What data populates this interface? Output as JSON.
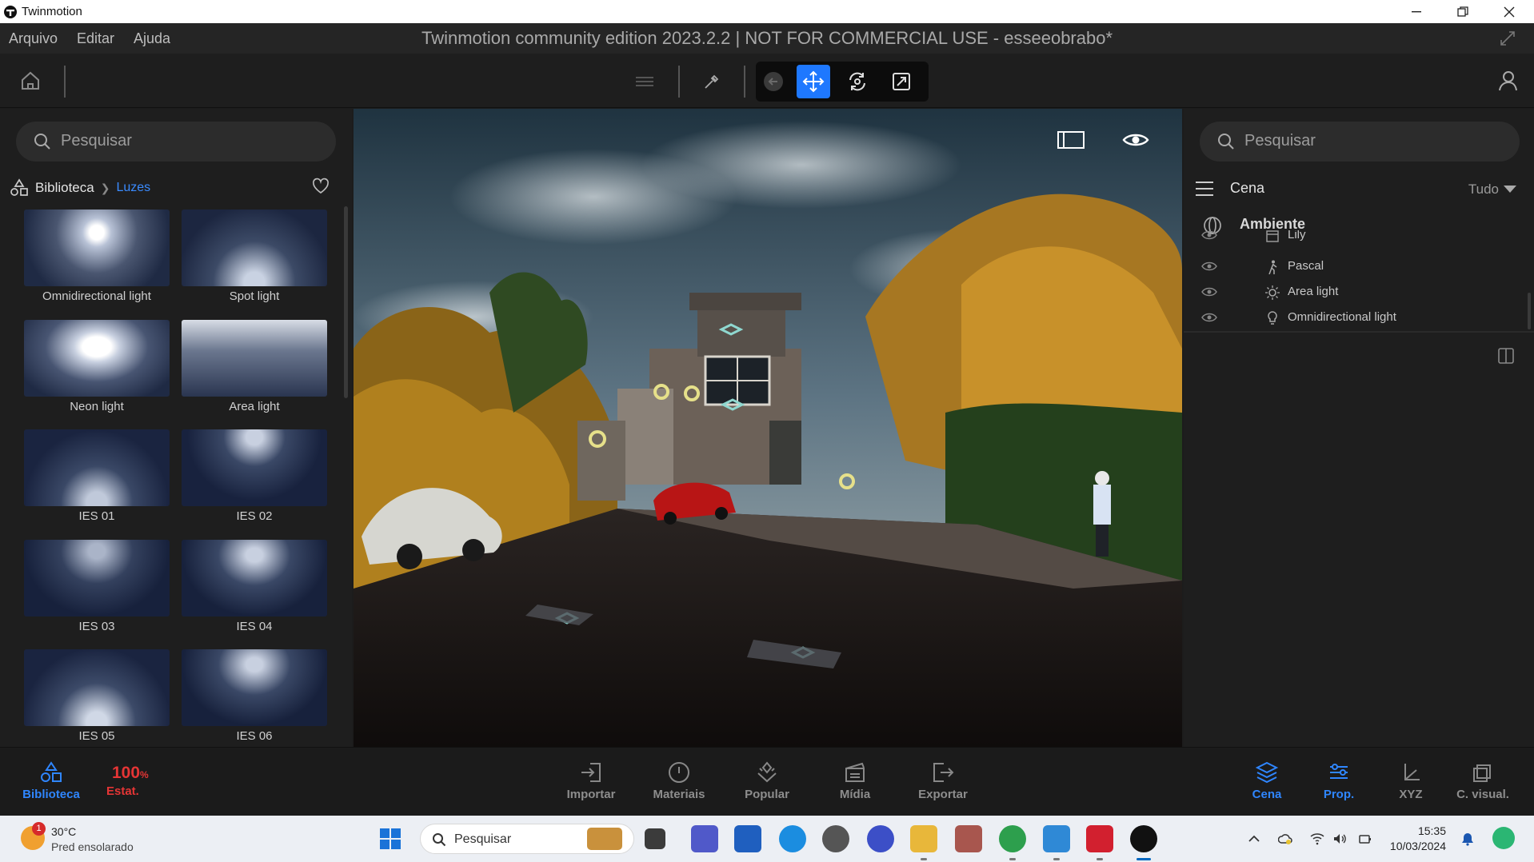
{
  "window": {
    "title": "Twinmotion",
    "app_title": "Twinmotion community edition 2023.2.2 | NOT FOR COMMERCIAL USE - esseeobrabo*"
  },
  "menu": {
    "items": [
      "Arquivo",
      "Editar",
      "Ajuda"
    ]
  },
  "library": {
    "search_placeholder": "Pesquisar",
    "breadcrumb_root": "Biblioteca",
    "breadcrumb_current": "Luzes",
    "items": [
      "Omnidirectional light",
      "Spot light",
      "Neon light",
      "Area light",
      "IES 01",
      "IES 02",
      "IES 03",
      "IES 04",
      "IES 05",
      "IES 06"
    ]
  },
  "scene_panel": {
    "search_placeholder": "Pesquisar",
    "title": "Cena",
    "filter": "Tudo",
    "group": "Ambiente",
    "rows": [
      "Lily",
      "Pascal",
      "Area light",
      "Omnidirectional light"
    ]
  },
  "bottom": {
    "left": [
      {
        "label": "Biblioteca"
      }
    ],
    "stat_value": "100",
    "stat_unit": "%",
    "stat_label": "Estat.",
    "center": [
      "Importar",
      "Materiais",
      "Popular",
      "Mídia",
      "Exportar"
    ],
    "right": [
      "Cena",
      "Prop.",
      "XYZ",
      "C. visual."
    ]
  },
  "taskbar": {
    "weather_badge": "1",
    "weather_temp": "30°C",
    "weather_desc": "Pred ensolarado",
    "search_placeholder": "Pesquisar",
    "time": "15:35",
    "date": "10/03/2024"
  },
  "colors": {
    "accent": "#1e78ff",
    "link": "#3a8bff",
    "alert": "#e53535"
  }
}
